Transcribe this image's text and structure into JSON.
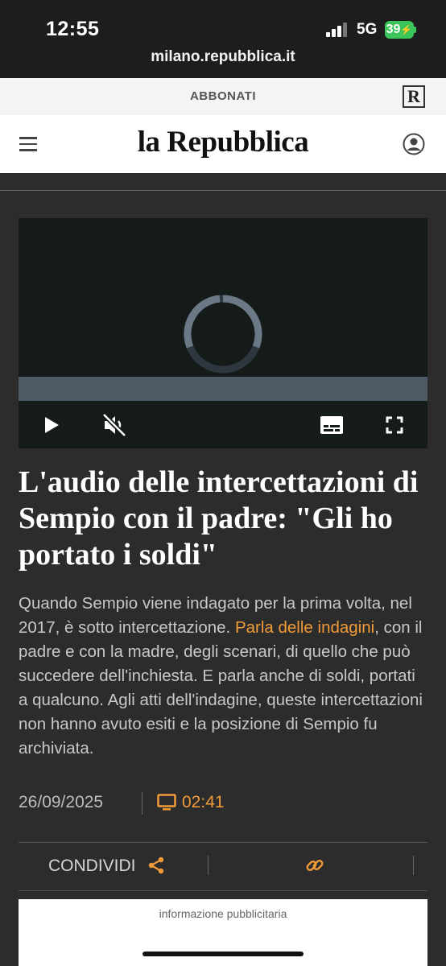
{
  "status_bar": {
    "time": "12:55",
    "network": "5G",
    "battery": "39"
  },
  "browser": {
    "url": "milano.repubblica.it"
  },
  "site": {
    "subscribe_label": "ABBONATI",
    "r_badge": "R",
    "logo": "la Repubblica"
  },
  "video": {
    "state": "loading",
    "muted": true
  },
  "article": {
    "headline": "L'audio delle intercettazioni di Sempio con il padre: \"Gli ho portato i soldi\"",
    "summary_before": "Quando Sempio viene indagato per la prima volta, nel 2017, è sotto intercettazione. ",
    "summary_link": "Parla delle indagini",
    "summary_after": ", con il padre e con la madre, degli scenari, di quello che può succedere dell'inchiesta. E parla anche di soldi, portati a qualcuno. Agli atti dell'indagine, queste intercettazioni non hanno avuto esiti e la posizione di Sempio fu archiviata.",
    "date": "26/09/2025",
    "duration": "02:41"
  },
  "share": {
    "label": "CONDIVIDI"
  },
  "ad": {
    "label": "informazione pubblicitaria"
  },
  "colors": {
    "accent": "#f19b38",
    "background": "#2c2c2c",
    "battery": "#3ac55a"
  }
}
